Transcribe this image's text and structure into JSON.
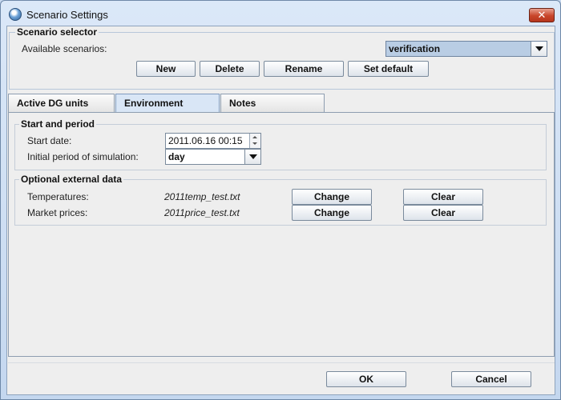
{
  "window": {
    "title": "Scenario Settings",
    "close_symbol": "✕"
  },
  "scenario_selector": {
    "title": "Scenario selector",
    "available_label": "Available scenarios:",
    "selected": "verification",
    "buttons": {
      "new": "New",
      "delete": "Delete",
      "rename": "Rename",
      "set_default": "Set default"
    }
  },
  "tabs": [
    {
      "label": "Active DG units",
      "selected": false
    },
    {
      "label": "Environment",
      "selected": true
    },
    {
      "label": "Notes",
      "selected": false
    }
  ],
  "start_period": {
    "title": "Start and period",
    "start_date_label": "Start date:",
    "start_date_value": "2011.06.16 00:15",
    "initial_period_label": "Initial period of simulation:",
    "initial_period_value": "day"
  },
  "external_data": {
    "title": "Optional external data",
    "rows": [
      {
        "label": "Temperatures:",
        "file": "2011temp_test.txt",
        "change": "Change",
        "clear": "Clear"
      },
      {
        "label": "Market prices:",
        "file": "2011price_test.txt",
        "change": "Change",
        "clear": "Clear"
      }
    ]
  },
  "footer": {
    "ok": "OK",
    "cancel": "Cancel"
  },
  "colors": {
    "title_bar": "#c9daf0",
    "close_button": "#c8452a",
    "selected_tab": "#d9e6f6",
    "client_bg": "#eeeeee"
  },
  "icons": {
    "app": "app-globe-icon",
    "close": "close-icon",
    "combo_arrow": "chevron-down-icon",
    "spinner": "spinner-arrows-icon"
  }
}
